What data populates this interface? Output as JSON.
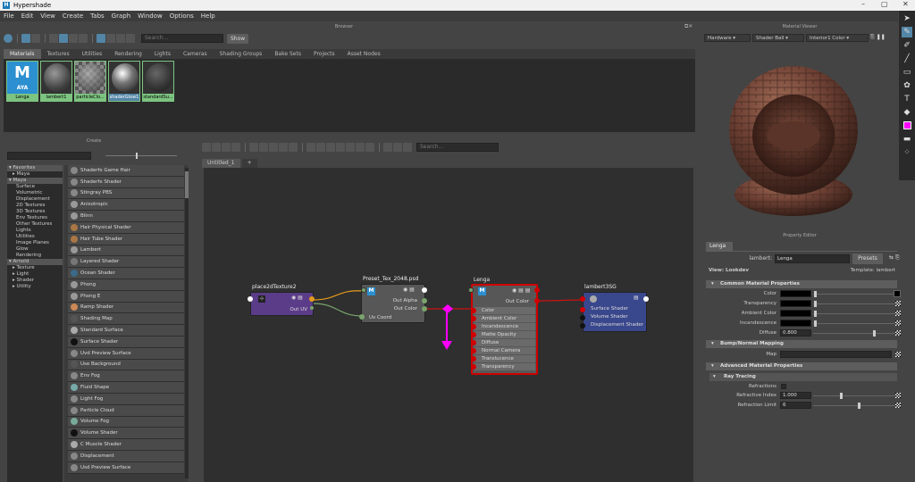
{
  "window": {
    "title": "Hypershade",
    "controls": {
      "min": "–",
      "max": "▢",
      "close": "✕"
    }
  },
  "menu": [
    "File",
    "Edit",
    "View",
    "Create",
    "Tabs",
    "Graph",
    "Window",
    "Options",
    "Help"
  ],
  "browser": {
    "title": "Browser",
    "search_placeholder": "Search...",
    "show_label": "Show",
    "tabs": [
      "Materials",
      "Textures",
      "Utilities",
      "Rendering",
      "Lights",
      "Cameras",
      "Shading Groups",
      "Bake Sets",
      "Projects",
      "Asset Nodes"
    ],
    "materials": [
      {
        "label": "Lenga",
        "thumb": "AYA"
      },
      {
        "label": "lambert1"
      },
      {
        "label": "particleClo..."
      },
      {
        "label": "shaderGlow1"
      },
      {
        "label": "standardSu..."
      }
    ]
  },
  "create": {
    "title": "Create",
    "tree": [
      {
        "t": "Favorites",
        "k": "cat"
      },
      {
        "t": "Maya",
        "k": "sub"
      },
      {
        "t": "Maya",
        "k": "cat"
      },
      {
        "t": "Surface"
      },
      {
        "t": "Volumetric"
      },
      {
        "t": "Displacement"
      },
      {
        "t": "2D Textures"
      },
      {
        "t": "3D Textures"
      },
      {
        "t": "Env Textures"
      },
      {
        "t": "Other Textures"
      },
      {
        "t": "Lights"
      },
      {
        "t": "Utilities"
      },
      {
        "t": "Image Planes"
      },
      {
        "t": "Glow"
      },
      {
        "t": "Rendering"
      },
      {
        "t": "Arnold",
        "k": "cat"
      },
      {
        "t": "Texture",
        "k": "sub"
      },
      {
        "t": "Light",
        "k": "sub"
      },
      {
        "t": "Shader",
        "k": "sub"
      },
      {
        "t": "Utility",
        "k": "sub"
      }
    ],
    "shaders": [
      {
        "n": "Shaderfx Game Hair",
        "c": "#888"
      },
      {
        "n": "Shaderfx Shader",
        "c": "#888"
      },
      {
        "n": "Stingray PBS",
        "c": "#888"
      },
      {
        "n": "Anisotropic",
        "c": "#999"
      },
      {
        "n": "Blinn",
        "c": "#999"
      },
      {
        "n": "Hair Physical Shader",
        "c": "#aa7744"
      },
      {
        "n": "Hair Tube Shader",
        "c": "#aa7744"
      },
      {
        "n": "Lambert",
        "c": "#999"
      },
      {
        "n": "Layered Shader",
        "c": "#777"
      },
      {
        "n": "Ocean Shader",
        "c": "#3a6a88"
      },
      {
        "n": "Phong",
        "c": "#999"
      },
      {
        "n": "Phong E",
        "c": "#999"
      },
      {
        "n": "Ramp Shader",
        "c": "#cc8855"
      },
      {
        "n": "Shading Map",
        "c": "#555"
      },
      {
        "n": "Standard Surface",
        "c": "#aaa"
      },
      {
        "n": "Surface Shader",
        "c": "#111"
      },
      {
        "n": "Uvd Preview Surface",
        "c": "#888"
      },
      {
        "n": "Use Background",
        "c": "#555"
      },
      {
        "n": "Env Fog",
        "c": "#888"
      },
      {
        "n": "Fluid Shape",
        "c": "#7aa"
      },
      {
        "n": "Light Fog",
        "c": "#888"
      },
      {
        "n": "Particle Cloud",
        "c": "#888"
      },
      {
        "n": "Volume Fog",
        "c": "#7a9"
      },
      {
        "n": "Volume Shader",
        "c": "#111"
      },
      {
        "n": "C Muscle Shader",
        "c": "#aaa"
      },
      {
        "n": "Displacement",
        "c": "#888"
      },
      {
        "n": "Usd Preview Surface",
        "c": "#888"
      }
    ]
  },
  "graph": {
    "search_placeholder": "Search...",
    "tabs": [
      "Untitled_1",
      "+"
    ],
    "nodes": {
      "place2d": {
        "title": "place2dTexture2",
        "out": "Out UV"
      },
      "file": {
        "title": "Preset_Tex_2048.psd",
        "outs": [
          "Out Alpha",
          "Out Color"
        ],
        "in": "Uv Coord"
      },
      "lenga": {
        "title": "Lenga",
        "out": "Out Color",
        "ins": [
          "Color",
          "Ambient Color",
          "Incandescence",
          "Matte Opacity",
          "Diffuse",
          "Normal Camera",
          "Translucence",
          "Transparency"
        ]
      },
      "sg": {
        "title": "lambert3SG",
        "ins": [
          "Surface Shader",
          "Volume Shader",
          "Displacement Shader"
        ]
      }
    }
  },
  "viewer": {
    "title": "Material Viewer",
    "renderer": "Hardware",
    "shape": "Shader Ball",
    "env": "Interior1 Color"
  },
  "prop": {
    "title": "Property Editor",
    "tab": "Lenga",
    "type_label": "lambert:",
    "name": "Lenga",
    "presets": "Presets",
    "view_label": "View: Lookdev",
    "template_label": "Template: lambert",
    "sections": {
      "common": "Common Material Properties",
      "bump": "Bump/Normal Mapping",
      "adv": "Advanced Material Properties",
      "ray": "Ray Tracing"
    },
    "rows": {
      "color": "Color",
      "transparency": "Transparency",
      "ambient": "Ambient Color",
      "incand": "Incandescence",
      "diffuse": "Diffuse",
      "map": "Map",
      "refractions": "Refractions",
      "rindex": "Refractive Index",
      "rlimit": "Refraction Limit"
    },
    "values": {
      "diffuse": "0.800",
      "rindex": "1.000",
      "rlimit": "6"
    }
  },
  "colors": {
    "accent": "#5285a6",
    "green": "#7dc481",
    "magenta": "#ff00ff",
    "red": "#d10000",
    "nodePurple": "#5b3c88",
    "nodeGray": "#575757",
    "nodeBlue": "#39478c"
  }
}
